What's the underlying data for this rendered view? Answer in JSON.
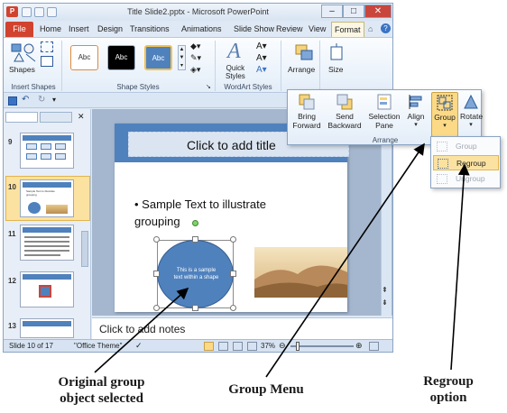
{
  "window": {
    "title": "Title Slide2.pptx - Microsoft PowerPoint",
    "min_glyph": "–",
    "max_glyph": "□",
    "close_glyph": "✕"
  },
  "ribbon": {
    "tabs": [
      "File",
      "Home",
      "Insert",
      "Design",
      "Transitions",
      "Animations",
      "Slide Show",
      "Review",
      "View",
      "Format"
    ],
    "active_tab": "Format",
    "groups": {
      "insert_shapes": "Insert Shapes",
      "shape_styles": "Shape Styles",
      "wordart_styles": "WordArt Styles",
      "arrange": "Arrange",
      "size": "Size"
    },
    "shapes_label": "Shapes",
    "style_swatches": [
      "Abc",
      "Abc",
      "Abc"
    ],
    "quick_styles_label": "Quick\nStyles",
    "arrange_label": "Arrange",
    "size_label": "Size"
  },
  "arrange_popup": {
    "buttons": [
      {
        "label": "Bring\nForward"
      },
      {
        "label": "Send\nBackward"
      },
      {
        "label": "Selection\nPane"
      },
      {
        "label": "Align"
      },
      {
        "label": "Group"
      },
      {
        "label": "Rotate"
      }
    ],
    "group_label": "Arrange"
  },
  "group_menu": {
    "items": [
      {
        "label": "Group",
        "enabled": false
      },
      {
        "label": "Regroup",
        "enabled": true
      },
      {
        "label": "Ungroup",
        "enabled": false
      }
    ]
  },
  "slides_panel": {
    "numbers": [
      "9",
      "10",
      "11",
      "12",
      "13"
    ],
    "selected": "10",
    "thumb10_text": "Sample Text to illustrate grouping",
    "thumb10_shape_text": "This is a sample"
  },
  "slide": {
    "title_placeholder": "Click to add title",
    "bullet": "Sample Text to illustrate grouping",
    "shape_text": "This is a sample\ntext within a shape"
  },
  "notes_placeholder": "Click to add notes",
  "status": {
    "slide_counter": "Slide 10 of 17",
    "theme": "\"Office Theme\"",
    "zoom": "37%"
  },
  "annotations": {
    "original_group": "Original group\nobject selected",
    "group_menu": "Group Menu",
    "regroup_option": "Regroup\noption"
  },
  "colors": {
    "accent_blue": "#4f81bd",
    "file_tab": "#d1432f",
    "highlight": "#fbd986"
  }
}
